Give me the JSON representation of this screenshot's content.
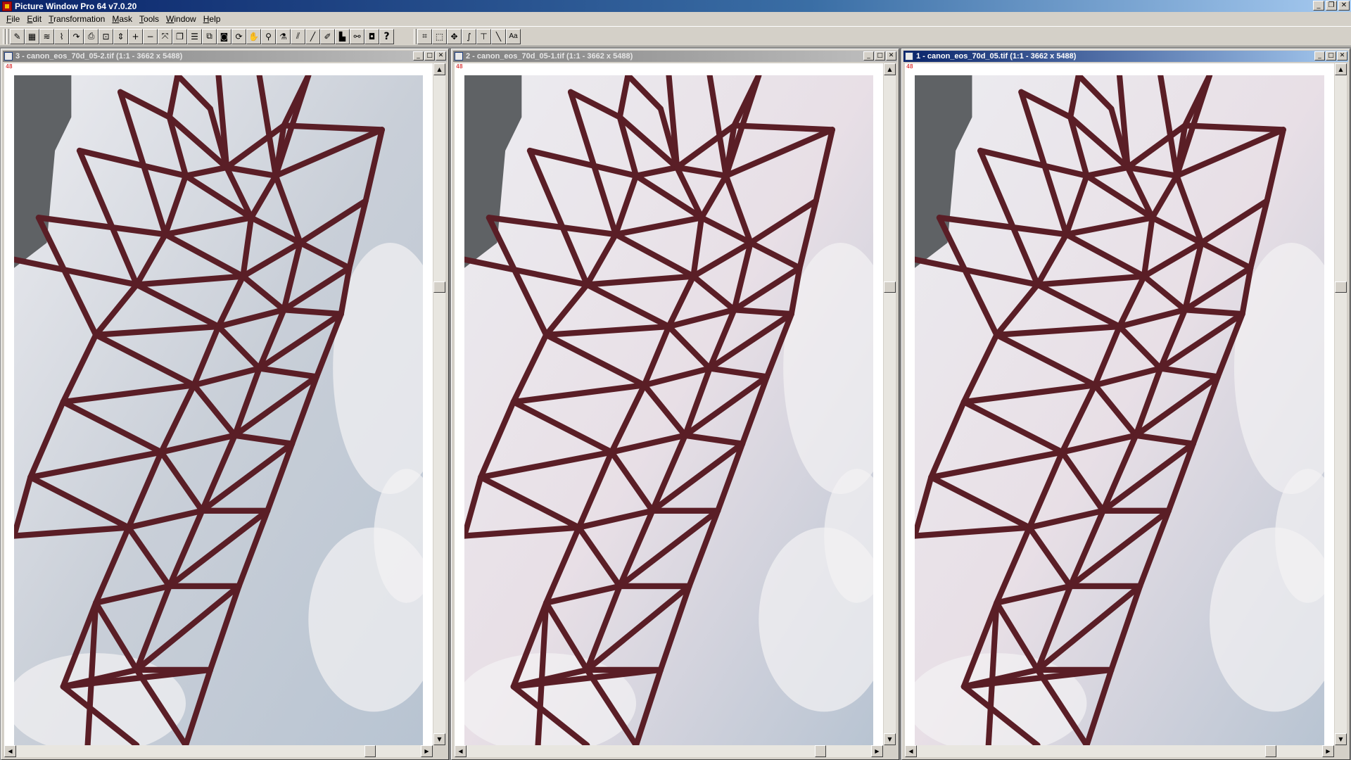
{
  "app": {
    "title": "Picture Window Pro 64  v7.0.20"
  },
  "menu": {
    "items": [
      {
        "key": "F",
        "rest": "ile"
      },
      {
        "key": "E",
        "rest": "dit"
      },
      {
        "key": "T",
        "rest": "ransformation"
      },
      {
        "key": "M",
        "rest": "ask"
      },
      {
        "key": "T",
        "rest": "ools"
      },
      {
        "key": "W",
        "rest": "indow"
      },
      {
        "key": "H",
        "rest": "elp"
      }
    ]
  },
  "toolbar": {
    "help_label": "?",
    "text_tool_label": "Aa"
  },
  "documents": [
    {
      "title": "3 - canon_eos_70d_05-2.tif (1:1 - 3662 x 5488)",
      "tag": "48",
      "active": false,
      "tint": "neutral"
    },
    {
      "title": "2 - canon_eos_70d_05-1.tif (1:1 - 3662 x 5488)",
      "tag": "48",
      "active": false,
      "tint": "pink"
    },
    {
      "title": "1 - canon_eos_70d_05.tif (1:1 - 3662 x 5488)",
      "tag": "48",
      "active": true,
      "tint": "pink"
    }
  ],
  "colors": {
    "title_active": "#0a246a",
    "structure": "#5a1e26",
    "sky_neutral": "#c9cfd8",
    "sky_pink": "#e8dfe6"
  }
}
